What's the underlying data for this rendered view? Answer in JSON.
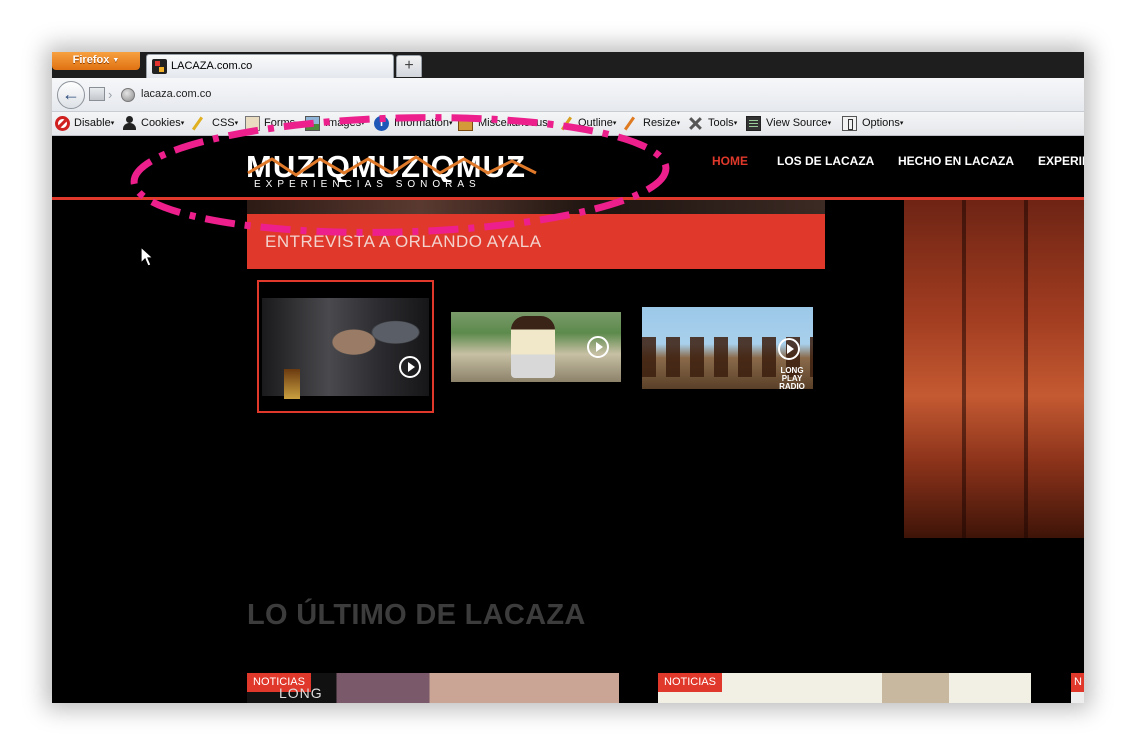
{
  "browser": {
    "menu_button": "Firefox",
    "menu_caret": "▼",
    "tab_title": "LACAZA.com.co",
    "new_tab": "+",
    "url": "lacaza.com.co",
    "back_glyph": "←"
  },
  "devbar": {
    "items": [
      {
        "label": "Disable",
        "icon": "disable-icon"
      },
      {
        "label": "Cookies",
        "icon": "cookies-icon"
      },
      {
        "label": "CSS",
        "icon": "css-icon"
      },
      {
        "label": "Forms",
        "icon": "forms-icon"
      },
      {
        "label": "Images",
        "icon": "images-icon"
      },
      {
        "label": "Information",
        "icon": "info-icon"
      },
      {
        "label": "Miscellaneous",
        "icon": "misc-icon"
      },
      {
        "label": "Outline",
        "icon": "outline-icon"
      },
      {
        "label": "Resize",
        "icon": "resize-icon"
      },
      {
        "label": "Tools",
        "icon": "tools-icon"
      },
      {
        "label": "View Source",
        "icon": "source-icon"
      },
      {
        "label": "Options",
        "icon": "options-icon"
      }
    ],
    "caret": "▾",
    "info_glyph": "i"
  },
  "site": {
    "logo_text": "MUZIQMUZIQMUZ",
    "logo_tagline": "EXPERIENCIAS SONORAS",
    "nav": [
      "HOME",
      "LOS DE LACAZA",
      "HECHO EN LACAZA",
      "EXPERIE"
    ],
    "active_nav": "HOME",
    "headline": "ENTREVISTA A ORLANDO AYALA",
    "thumbnail_3_badge": "LONG PLAY RADIO",
    "section_heading": "LO ÚLTIMO DE LACAZA",
    "cards": [
      {
        "tag": "NOTICIAS",
        "logo": "LONG"
      },
      {
        "tag": "NOTICIAS"
      },
      {
        "tag": "N"
      }
    ]
  },
  "colors": {
    "accent_red": "#e0392b",
    "annotation_pink": "#ec1f8c",
    "firefox_orange": "#e07212",
    "page_bg": "#000000"
  }
}
